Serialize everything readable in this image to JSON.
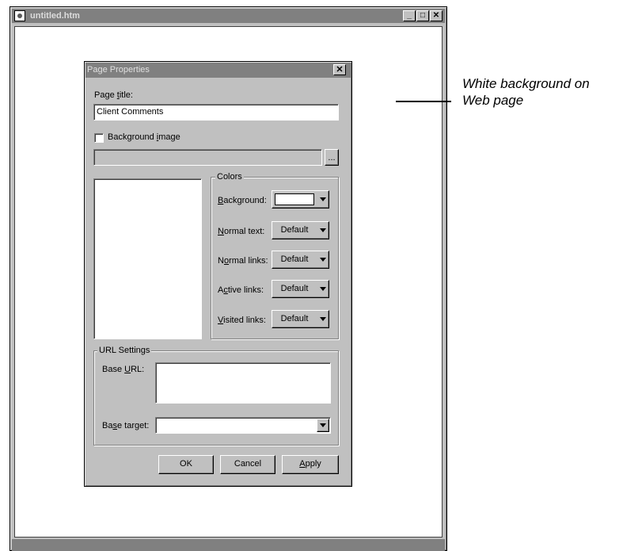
{
  "window": {
    "title": "untitled.htm",
    "minimize": "_",
    "maximize": "□",
    "close": "✕"
  },
  "dialog": {
    "title": "Page Properties",
    "close": "✕",
    "page_title_label": "Page title:",
    "page_title_value": "Client Comments",
    "background_image_label": "Background image",
    "background_image_checked": false,
    "browse_label": "...",
    "colors": {
      "group_label": "Colors",
      "rows": [
        {
          "label": "Background:",
          "value": ""
        },
        {
          "label": "Normal text:",
          "value": "Default"
        },
        {
          "label": "Normal links:",
          "value": "Default"
        },
        {
          "label": "Active links:",
          "value": "Default"
        },
        {
          "label": "Visited links:",
          "value": "Default"
        }
      ]
    },
    "url_settings": {
      "group_label": "URL Settings",
      "base_url_label": "Base URL:",
      "base_url_value": "",
      "base_target_label": "Base target:",
      "base_target_value": ""
    },
    "buttons": {
      "ok": "OK",
      "cancel": "Cancel",
      "apply": "Apply"
    }
  },
  "annotation": {
    "line1": "White background on",
    "line2": "Web page"
  }
}
